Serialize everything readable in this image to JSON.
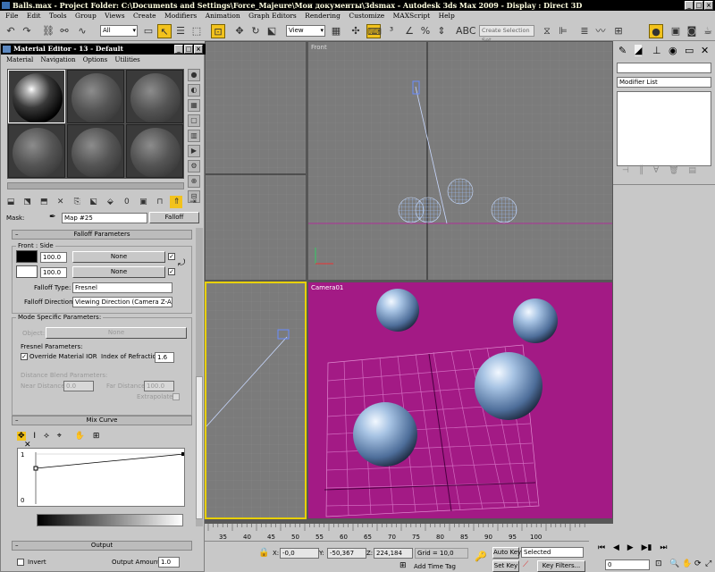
{
  "title_bar": {
    "text": "Balls.max    - Project Folder: C:\\Documents and Settings\\Force_Majeure\\Мои документы\\3dsmax    - Autodesk 3ds Max  2009      - Display : Direct 3D"
  },
  "menu": [
    "File",
    "Edit",
    "Tools",
    "Group",
    "Views",
    "Create",
    "Modifiers",
    "Animation",
    "Graph Editors",
    "Rendering",
    "Customize",
    "MAXScript",
    "Help"
  ],
  "toolbar": {
    "selection_filter": "All",
    "ref_coord": "View",
    "named_selection_placeholder": "Create Selection Set"
  },
  "material_editor": {
    "title": "Material Editor - 13 - Default",
    "menu": [
      "Material",
      "Navigation",
      "Options",
      "Utilities"
    ],
    "mask_label": "Mask:",
    "map_name": "Map #25",
    "map_type": "Falloff",
    "falloff_params": {
      "header": "Falloff Parameters",
      "front_side_label": "Front : Side",
      "front_amount": "100.0",
      "front_map": "None",
      "side_amount": "100.0",
      "side_map": "None",
      "falloff_type_label": "Falloff Type:",
      "falloff_type": "Fresnel",
      "falloff_direction_label": "Falloff Direction:",
      "falloff_direction": "Viewing Direction (Camera Z-Axis)"
    },
    "mode_specific": {
      "header": "Mode Specific Parameters:",
      "object_label": "Object:",
      "object_value": "None",
      "fresnel_label": "Fresnel Parameters:",
      "override_ior_label": "Override Material IOR",
      "ior_label": "Index of Refraction",
      "ior_value": "1.6",
      "distance_blend_label": "Distance Blend Parameters:",
      "near_distance_label": "Near Distance:",
      "near_distance_value": "0.0",
      "far_distance_label": "Far Distance:",
      "far_distance_value": "100.0",
      "extrapolate_label": "Extrapolate"
    },
    "mix_curve": {
      "header": "Mix Curve",
      "y_top": "1",
      "y_bottom": "0"
    },
    "output": {
      "header": "Output",
      "invert_label": "Invert",
      "output_amount_label": "Output Amount:",
      "output_amount": "1.0"
    }
  },
  "viewports": {
    "front_label": "Front",
    "camera_label": "Camera01"
  },
  "command_panel": {
    "modifier_list": "Modifier List"
  },
  "status": {
    "timeline_ticks": [
      "35",
      "40",
      "45",
      "50",
      "55",
      "60",
      "65",
      "70",
      "75",
      "80",
      "85",
      "90",
      "95",
      "100"
    ],
    "x_label": "X:",
    "x_value": "-0,0",
    "y_label": "Y:",
    "y_value": "-50,367",
    "z_label": "Z:",
    "z_value": "224,184",
    "grid": "Grid = 10,0",
    "add_time_tag": "Add Time Tag",
    "auto_key": "Auto Key",
    "set_key": "Set Key",
    "selected": "Selected",
    "key_filters": "Key Filters...",
    "frame": "0"
  }
}
